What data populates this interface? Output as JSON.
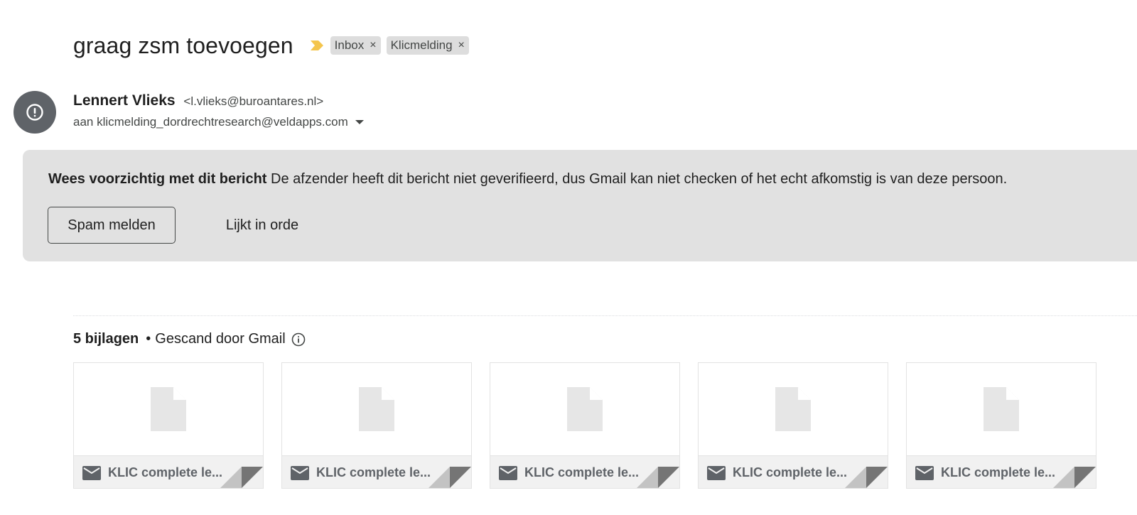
{
  "email": {
    "subject": "graag zsm toevoegen",
    "labels": [
      {
        "name": "Inbox",
        "remove": "×"
      },
      {
        "name": "Klicmelding",
        "remove": "×"
      }
    ],
    "sender": {
      "name": "Lennert Vlieks",
      "email": "<l.vlieks@buroantares.nl>"
    },
    "recipient_line": "aan klicmelding_dordrechtresearch@veldapps.com"
  },
  "warning": {
    "title": "Wees voorzichtig met dit bericht",
    "text": "De afzender heeft dit bericht niet geverifieerd, dus Gmail kan niet checken of het echt afkomstig is van deze persoon.",
    "report_spam_label": "Spam melden",
    "looks_safe_label": "Lijkt in orde"
  },
  "attachments": {
    "count_label": "5 bijlagen",
    "separator": "•",
    "scan_label": "Gescand door Gmail",
    "items": [
      {
        "name": "KLIC complete le..."
      },
      {
        "name": "KLIC complete le..."
      },
      {
        "name": "KLIC complete le..."
      },
      {
        "name": "KLIC complete le..."
      },
      {
        "name": "KLIC complete le..."
      }
    ]
  },
  "colors": {
    "importance_marker": "#f4c54d",
    "warning_bg": "#e1e1e1",
    "avatar_bg": "#5f6368",
    "chip_bg": "#dddddd"
  },
  "icons": {
    "avatar": "alert-icon",
    "importance": "importance-marker-icon",
    "info": "info-icon",
    "attachment_type": "mail-icon",
    "attachment_preview": "file-icon"
  }
}
